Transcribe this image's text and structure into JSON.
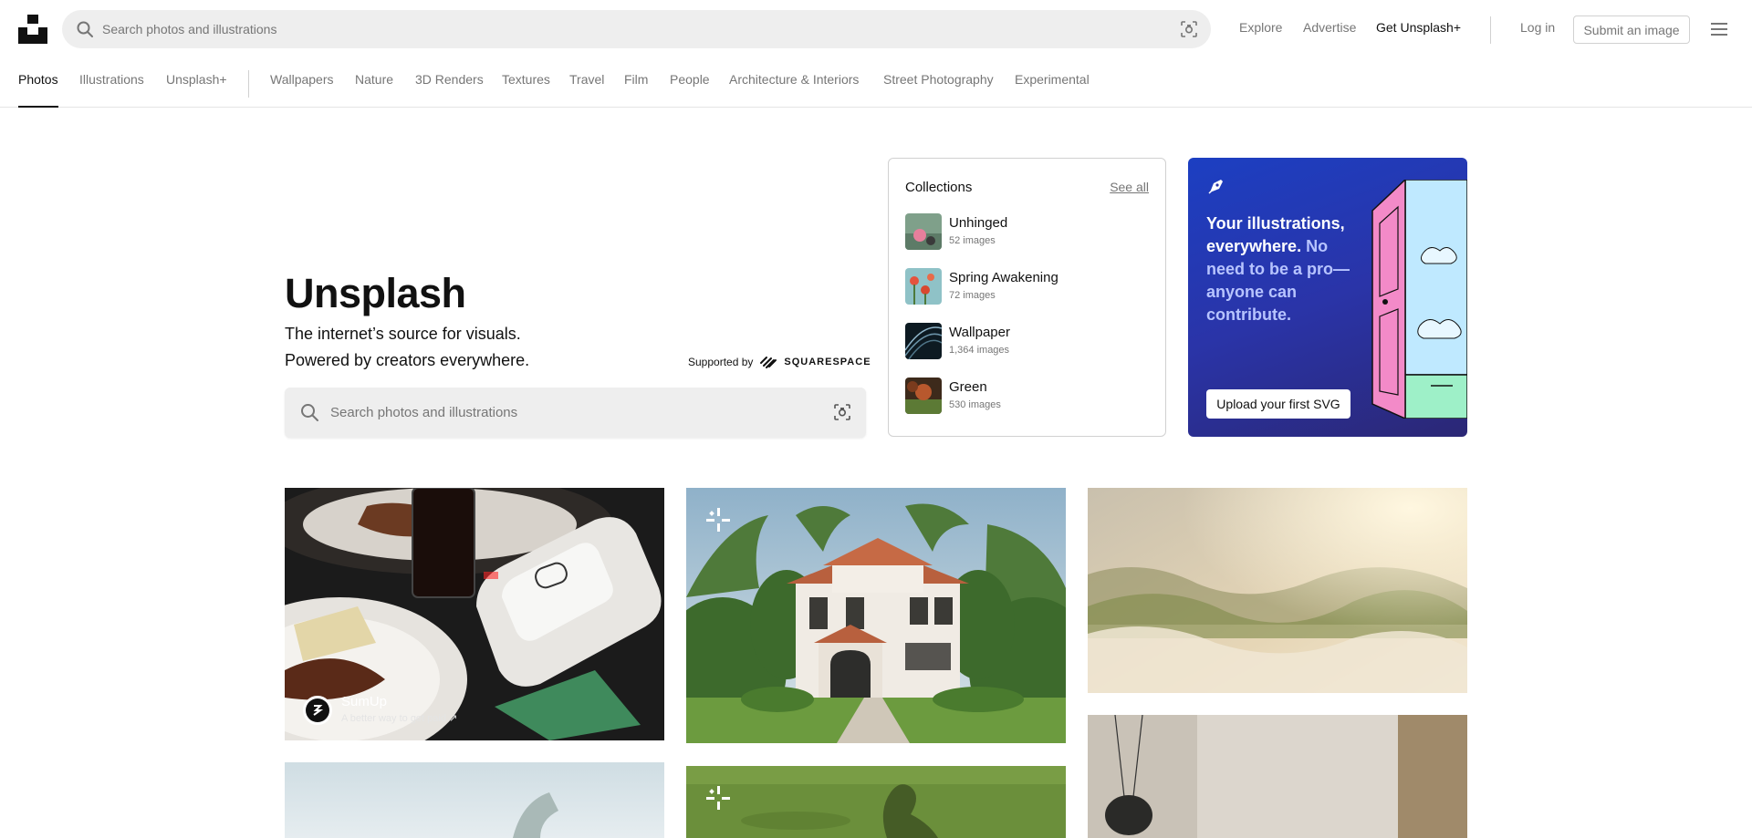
{
  "header": {
    "search_placeholder": "Search photos and illustrations",
    "links": [
      "Explore",
      "Advertise",
      "Get Unsplash+"
    ],
    "login": "Log in",
    "submit": "Submit an image"
  },
  "categories": {
    "primary": [
      "Photos",
      "Illustrations",
      "Unsplash+"
    ],
    "topics": [
      "Wallpapers",
      "Nature",
      "3D Renders",
      "Textures",
      "Travel",
      "Film",
      "People",
      "Architecture & Interiors",
      "Street Photography",
      "Experimental"
    ],
    "active": "Photos"
  },
  "hero": {
    "title": "Unsplash",
    "line1": "The internet’s source for visuals.",
    "line2": "Powered by creators everywhere.",
    "supported_by": "Supported by",
    "sponsor_brand": "SQUARESPACE",
    "search_placeholder": "Search photos and illustrations"
  },
  "collections": {
    "title": "Collections",
    "see_all": "See all",
    "items": [
      {
        "name": "Unhinged",
        "count": "52 images"
      },
      {
        "name": "Spring Awakening",
        "count": "72 images"
      },
      {
        "name": "Wallpaper",
        "count": "1,364 images"
      },
      {
        "name": "Green",
        "count": "530 images"
      }
    ]
  },
  "promo": {
    "headline": "Your illustrations, everywhere.",
    "body": " No need to be a pro—anyone can contribute.",
    "button": "Upload your first SVG"
  },
  "sponsored_photo": {
    "name": "SumUp",
    "tagline": "A better way to get paid ↗"
  },
  "colors": {
    "accent_text": "#111111",
    "muted_text": "#767676",
    "search_bg": "#eeeeee",
    "promo_blue": "#2a34a8"
  }
}
